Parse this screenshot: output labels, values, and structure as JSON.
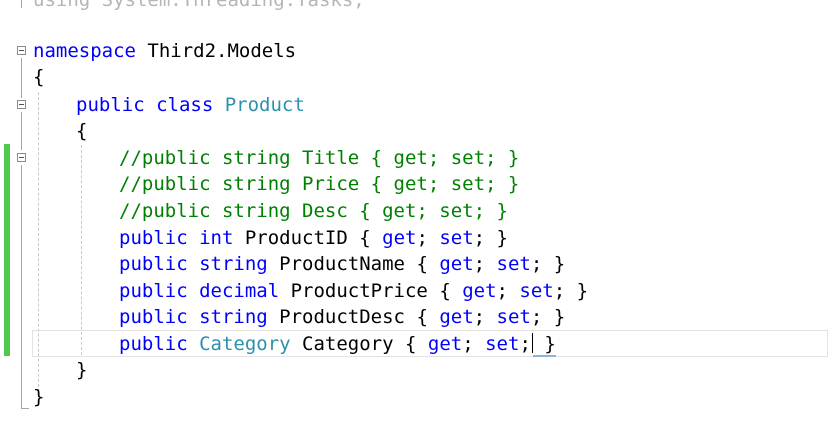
{
  "editor": {
    "line_using": "using System.Threading.Tasks;",
    "ns_keyword": "namespace",
    "ns_name": " Third2.Models",
    "open_brace": "{",
    "close_brace": "}",
    "class_mod": "public class",
    "class_name": "Product",
    "comment_title": "//public string Title { get; set; }",
    "comment_price": "//public string Price { get; set; }",
    "comment_desc": "//public string Desc { get; set; }",
    "p1": {
      "mod": "public int",
      "name": " ProductID ",
      "acc_open": "{ ",
      "get": "get",
      "sep": "; ",
      "set": "set",
      "acc_close": "; }"
    },
    "p2": {
      "mod": "public string",
      "name": " ProductName ",
      "acc_open": "{ ",
      "get": "get",
      "sep": "; ",
      "set": "set",
      "acc_close": "; }"
    },
    "p3": {
      "mod": "public decimal",
      "name": " ProductPrice ",
      "acc_open": "{ ",
      "get": "get",
      "sep": "; ",
      "set": "set",
      "acc_close": "; }"
    },
    "p4": {
      "mod": "public string",
      "name": " ProductDesc ",
      "acc_open": "{ ",
      "get": "get",
      "sep": "; ",
      "set": "set",
      "acc_close": "; }"
    },
    "p5": {
      "mod": "public",
      "type": "Category",
      "name": " Category ",
      "acc_open": "{ ",
      "get": "get",
      "sep": "; ",
      "set": "set",
      "semi": ";",
      "acc_close": " }"
    }
  },
  "colors": {
    "keyword": "#0000ff",
    "type": "#2b91af",
    "comment": "#008000",
    "change_bar": "#4ec94e"
  }
}
